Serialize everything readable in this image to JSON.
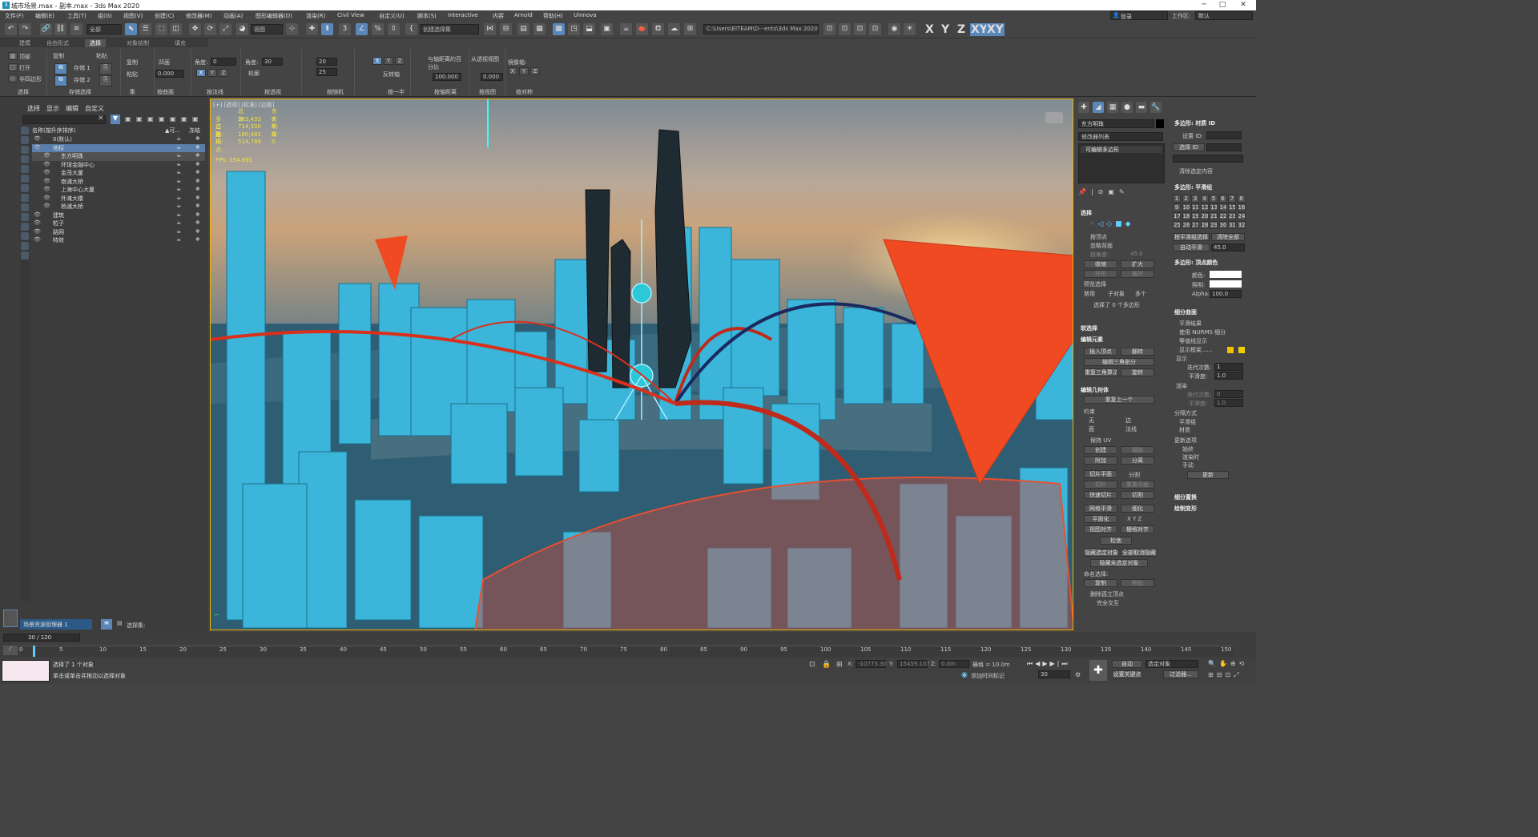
{
  "window": {
    "title": "城市场景.max - 副本.max - 3ds Max 2020",
    "min": "─",
    "max": "□",
    "close": "✕"
  },
  "menu": [
    "文件(F)",
    "编辑(E)",
    "工具(T)",
    "组(G)",
    "视图(V)",
    "创建(C)",
    "修改器(M)",
    "动画(A)",
    "图形编辑器(D)",
    "渲染(R)",
    "Civil View",
    "自定义(U)",
    "脚本(S)",
    "Interactive",
    "内容",
    "Arnold",
    "帮助(H)",
    "Uinnova"
  ],
  "account": {
    "login": "登录",
    "workspace_label": "工作区:",
    "workspace": "默认"
  },
  "toolbar": {
    "filter": "全部",
    "view": "视图",
    "selset": "创建选择集",
    "path": "C:\\Users\\EITEAM\\D···ents\\3ds Max 2020",
    "axes": [
      "X",
      "Y",
      "Z",
      "XY",
      "XY"
    ]
  },
  "ribbon_tabs": [
    "建模",
    "自由形式",
    "选择",
    "对象绘制",
    "填充"
  ],
  "ribbon": {
    "sel_top": "顶部",
    "sel_open": "打开",
    "sel_nonquad": "非四边形",
    "sel_title": "选择",
    "copy": "复制",
    "paste": "粘贴",
    "store1": "存储 1",
    "store2": "存储 2",
    "store_title": "存储选择",
    "set_copy": "复制",
    "set_paste": "粘贴",
    "set_title": "集",
    "concave": "凹面",
    "concave_val": "0.000",
    "angle_label": "角度:",
    "angle_val": "0",
    "bycurve_title": "按曲面",
    "angle2_label": "角度:",
    "angle2_val": "30",
    "outline": "轮廓",
    "bynormal_title": "按法线",
    "persp_title": "按透视",
    "rand1": "20",
    "rand2": "25",
    "random_title": "按随机",
    "half_title": "按一半",
    "flip": "反转轴",
    "pct_label": "与轴距离的百分比",
    "pct_val": "100.000",
    "dist_title": "按轴距离",
    "from_label": "从透视视图",
    "from_val": "0.000",
    "view_title": "按视图",
    "mirror_label": "镜像轴:",
    "sym_title": "按对称"
  },
  "scene": {
    "menu": [
      "选择",
      "显示",
      "编辑",
      "自定义"
    ],
    "col_name": "名称(按升序排序)",
    "col_vis": "▲可...",
    "col_freeze": "冻结",
    "rows": [
      {
        "name": "0(默认)",
        "indent": 0,
        "state": ""
      },
      {
        "name": "地标",
        "indent": 0,
        "state": "sel"
      },
      {
        "name": "东方明珠",
        "indent": 1,
        "state": "hi"
      },
      {
        "name": "环球金融中心",
        "indent": 1,
        "state": ""
      },
      {
        "name": "金茂大厦",
        "indent": 1,
        "state": ""
      },
      {
        "name": "南浦大桥",
        "indent": 1,
        "state": ""
      },
      {
        "name": "上海中心大厦",
        "indent": 1,
        "state": ""
      },
      {
        "name": "外滩大楼",
        "indent": 1,
        "state": ""
      },
      {
        "name": "杨浦大桥",
        "indent": 1,
        "state": ""
      },
      {
        "name": "建筑",
        "indent": 0,
        "state": ""
      },
      {
        "name": "粒子",
        "indent": 0,
        "state": ""
      },
      {
        "name": "路网",
        "indent": 0,
        "state": ""
      },
      {
        "name": "特效",
        "indent": 0,
        "state": ""
      }
    ],
    "bottom_tab": "场景资源管理器 1",
    "selset_label": "选择集:"
  },
  "viewport": {
    "label": "[+] [透视] [标准] [边面]",
    "stats": [
      [
        "",
        "总计",
        "东方明珠"
      ],
      [
        "多边形:",
        "383,433",
        "0"
      ],
      [
        "三角形:",
        "714,500",
        "0"
      ],
      [
        "边:",
        "180,481",
        "0"
      ],
      [
        "顶点:",
        "514,789",
        "0"
      ]
    ],
    "fps": "FPS:  154.891"
  },
  "cmd": {
    "name": "东方明珠",
    "modlist": "修改器列表",
    "stack_item": "可编辑多边形",
    "sel_head": "选择",
    "byvertex": "按顶点",
    "ignore_back": "忽略背面",
    "byangle": "按角度:",
    "byangle_val": "45.0",
    "shrink": "收缩",
    "grow": "扩大",
    "ring": "环形",
    "loop": "循环",
    "preview": "预览选择",
    "disable": "禁用",
    "subobj": "子对象",
    "multi": "多个",
    "selcount": "选择了 0 个多边形",
    "soft": "软选择",
    "edit_elem": "编辑元素",
    "insert_v": "插入顶点",
    "flip": "翻转",
    "edit_tri": "编辑三角剖分",
    "retri": "重复三角算法",
    "turn": "旋转",
    "edit_geo": "编辑几何体",
    "repeat": "重复上一个",
    "constraint": "约束",
    "none": "无",
    "edge": "边",
    "face": "面",
    "normal": "法线",
    "preserve_uv": "保持 UV",
    "create": "创建",
    "collapse": "塌陷",
    "attach": "附加",
    "detach": "分离",
    "slice_plane": "切片平面",
    "split": "分割",
    "slice": "切片",
    "reset_plane": "重置平面",
    "quick_slice": "快速切片",
    "cut": "切割",
    "msmooth": "网格平滑",
    "tess": "细化",
    "planar": "平面化",
    "view_align": "视图对齐",
    "grid_align": "栅格对齐",
    "relax": "松弛",
    "hide_sel": "隐藏选定对象",
    "unhide_all": "全部取消隐藏",
    "hide_unsel": "隐藏未选定对象",
    "named_sel": "命名选择:",
    "copy": "复制",
    "paste": "粘贴",
    "del_iso": "删除孤立顶点",
    "full_inter": "完全交互"
  },
  "rolls": {
    "matid_head": "多边形: 材质 ID",
    "set_id": "设置 ID:",
    "select_id": "选择 ID",
    "clear_sel": "清除选定内容",
    "smooth_head": "多边形: 平滑组",
    "groups": [
      "1",
      "2",
      "3",
      "4",
      "5",
      "6",
      "7",
      "8",
      "9",
      "10",
      "11",
      "12",
      "13",
      "14",
      "15",
      "16",
      "17",
      "18",
      "19",
      "20",
      "21",
      "22",
      "23",
      "24",
      "25",
      "26",
      "27",
      "28",
      "29",
      "30",
      "31",
      "32"
    ],
    "sel_by_sg": "按平滑组选择",
    "clear_all": "清除全部",
    "autosmooth": "自动平滑",
    "autosmooth_val": "45.0",
    "vcolor_head": "多边形: 顶点颜色",
    "color": "颜色:",
    "illum": "照明:",
    "alpha": "Alpha:",
    "alpha_val": "100.0",
    "subdiv_head": "细分曲面",
    "smooth_result": "平滑结果",
    "use_nurms": "使用 NURMS 细分",
    "isoline": "等值线显示",
    "show_cage": "显示框架......",
    "display": "显示",
    "iter": "迭代次数:",
    "iter_val": "1",
    "smooth": "平滑度:",
    "smooth_val": "1.0",
    "render": "渲染",
    "riter_val": "0",
    "rsmooth_val": "1.0",
    "sep": "分隔方式",
    "smooth_grp": "平滑组",
    "material": "材质",
    "update": "更新选项",
    "always": "始终",
    "when_render": "渲染时",
    "manual": "手动",
    "update_btn": "更新",
    "disp_head": "细分置换",
    "paint_head": "绘制变形"
  },
  "timeline": {
    "frame": "30 / 120",
    "ticks": [
      "0",
      "5",
      "10",
      "15",
      "20",
      "25",
      "30",
      "35",
      "40",
      "45",
      "50",
      "55",
      "60",
      "65",
      "70",
      "75",
      "80",
      "85",
      "90",
      "95",
      "100",
      "105",
      "110",
      "115",
      "120",
      "125",
      "130",
      "135",
      "140",
      "145",
      "150"
    ]
  },
  "status": {
    "line1": "选择了 1 个对象",
    "line2": "单击或单击并拖动以选择对象",
    "x": "-10773.30",
    "y": "15459.107",
    "z": "0.0m",
    "grid": "栅格 = 10.0m",
    "addtime": "添加时间标记",
    "auto": "自动",
    "selobj": "选定对象",
    "setkey": "设置关键点",
    "filters": "过滤器...",
    "frame": "30"
  }
}
